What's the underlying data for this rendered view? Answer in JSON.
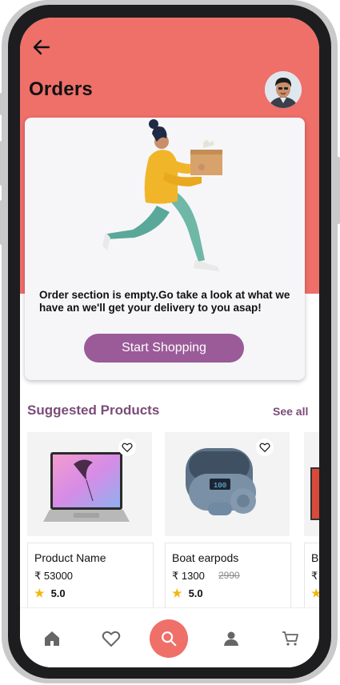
{
  "header": {
    "title": "Orders",
    "back_icon": "arrow-left-icon",
    "avatar_icon": "user-avatar"
  },
  "empty_state": {
    "message": "Order section is empty.Go take a look at what we have an we'll get your delivery to you asap!",
    "button_label": "Start Shopping",
    "illustration": "delivery-person-illustration"
  },
  "suggested": {
    "title": "Suggested Products",
    "see_all": "See all",
    "products": [
      {
        "name": "Product Name",
        "price": "₹ 53000",
        "old_price": "",
        "rating": "5.0",
        "image": "laptop-image"
      },
      {
        "name": "Boat earpods",
        "price": "₹ 1300",
        "old_price": "2990",
        "rating": "5.0",
        "image": "earbuds-image"
      },
      {
        "name": "Bo",
        "price": "₹",
        "old_price": "",
        "rating": "",
        "image": "tv-image"
      }
    ]
  },
  "nav": {
    "items": [
      "home-icon",
      "heart-icon",
      "search-icon",
      "user-icon",
      "cart-icon"
    ]
  },
  "colors": {
    "accent": "#ef6f69",
    "button": "#9a5b98",
    "section_title": "#7a4c78",
    "star": "#f1b70f"
  }
}
